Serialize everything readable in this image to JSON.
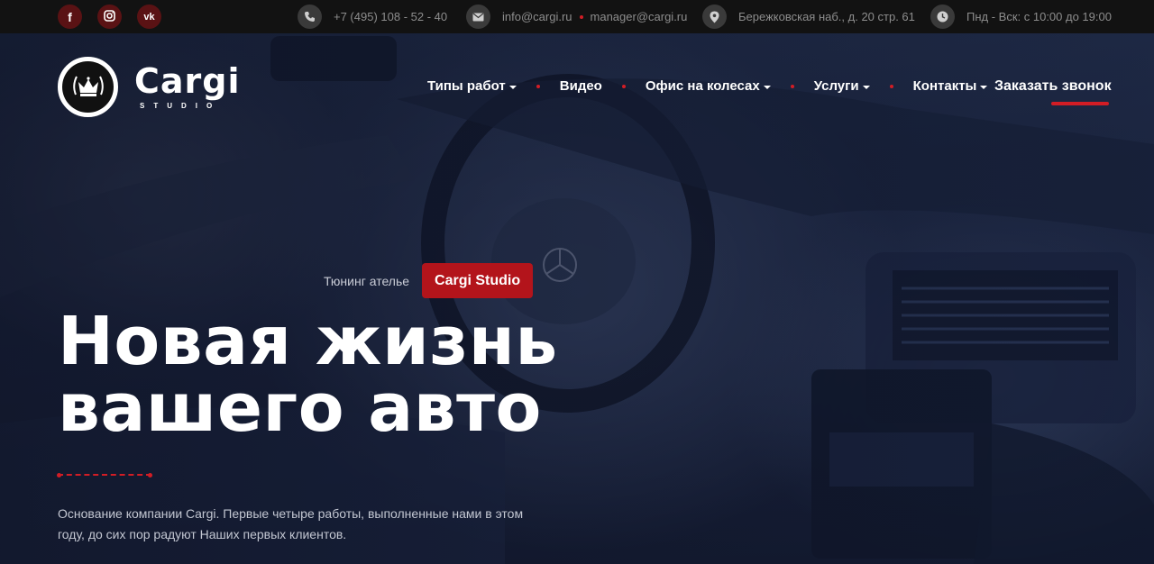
{
  "topbar": {
    "social": [
      {
        "icon": "facebook-icon",
        "glyph": "f"
      },
      {
        "icon": "instagram-icon",
        "glyph": ""
      },
      {
        "icon": "vk-icon",
        "glyph": "vk"
      }
    ],
    "phone": "+7 (495) 108 - 52 - 40",
    "email_1": "info@cargi.ru",
    "email_2": "manager@cargi.ru",
    "address": "Бережковская наб., д. 20 стр. 61",
    "hours": "Пнд - Вск: с 10:00 до 19:00"
  },
  "logo": {
    "name": "Cargi",
    "subtitle": "STUDIO"
  },
  "nav": {
    "items": [
      {
        "label": "Типы работ",
        "dropdown": true
      },
      {
        "label": "Видео",
        "dropdown": false
      },
      {
        "label": "Офис на колесах",
        "dropdown": true
      },
      {
        "label": "Услуги",
        "dropdown": true
      },
      {
        "label": "Контакты",
        "dropdown": true
      }
    ],
    "cta": "Заказать звонок"
  },
  "hero": {
    "eyebrow": "Тюнинг ателье",
    "badge": "Cargi Studio",
    "headline_line1": "Новая жизнь",
    "headline_line2": "вашего авто",
    "description": "Основание компании Cargi. Первые четыре работы, выполненные нами в этом году, до сих пор радуют Наших первых клиентов."
  },
  "colors": {
    "accent": "#d21d25",
    "badge": "#b3141b",
    "topbar": "#121212",
    "social_bg": "#5a1214"
  }
}
